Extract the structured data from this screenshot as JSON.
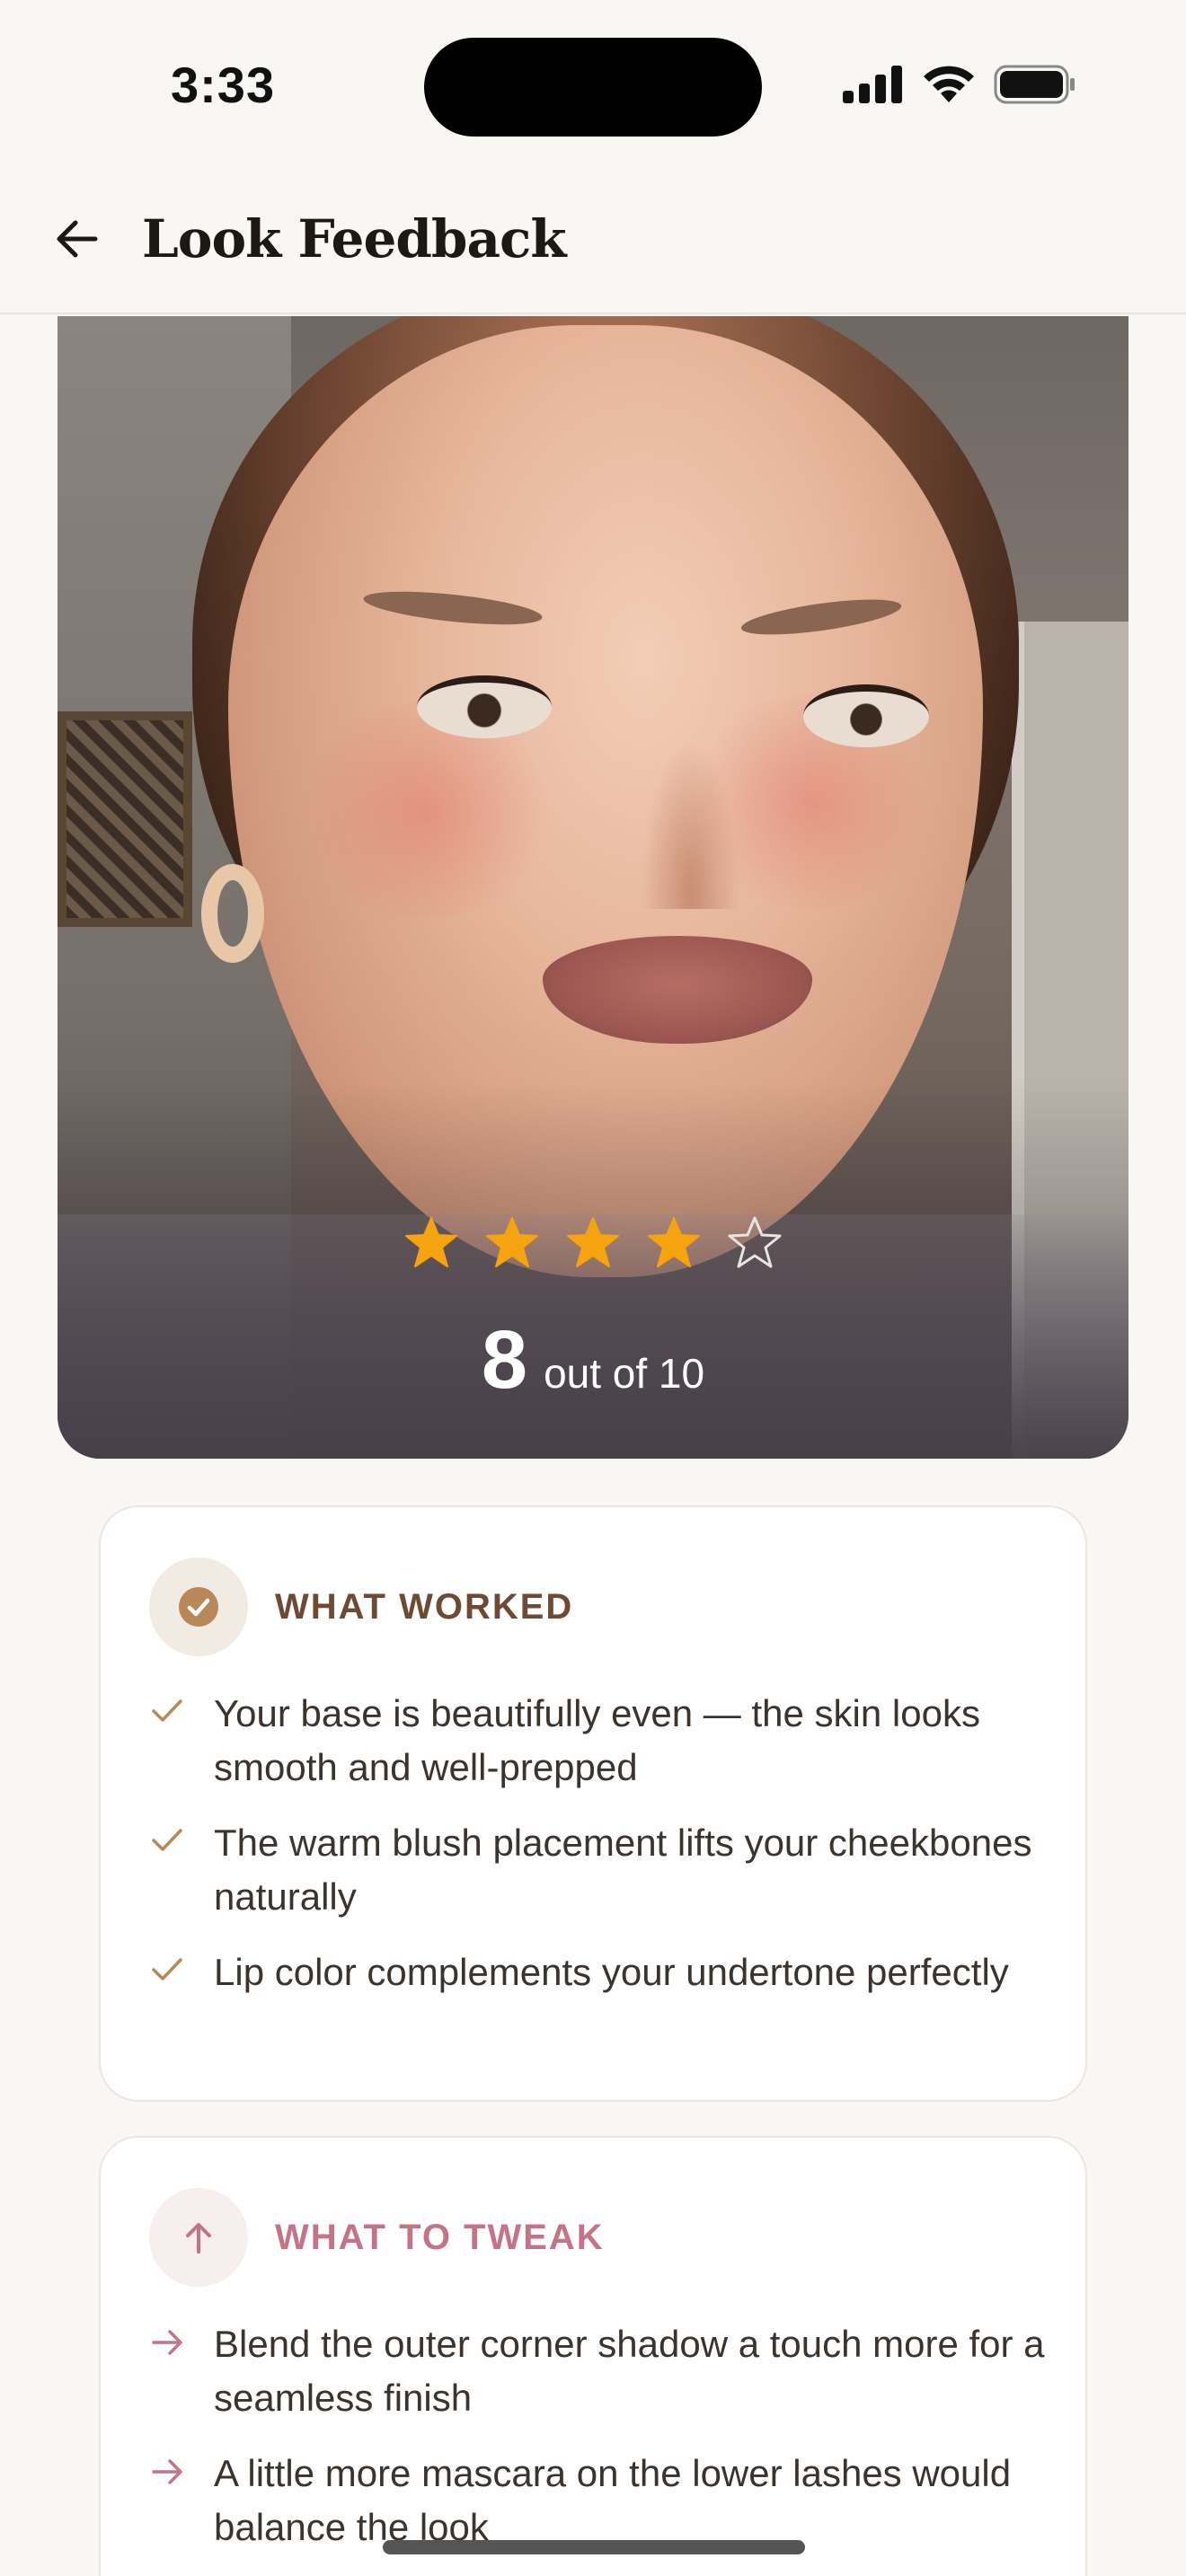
{
  "status_bar": {
    "time": "3:33"
  },
  "header": {
    "title": "Look Feedback"
  },
  "rating": {
    "stars_filled": 4,
    "stars_total": 5,
    "score": "8",
    "score_suffix": "out of 10"
  },
  "what_worked": {
    "heading": "WHAT WORKED",
    "items": [
      "Your base is beautifully even — the skin looks smooth and well-prepped",
      "The warm blush placement lifts your cheekbones naturally",
      "Lip color complements your undertone perfectly"
    ]
  },
  "what_to_tweak": {
    "heading": "WHAT TO TWEAK",
    "items": [
      "Blend the outer corner shadow a touch more for a seamless finish",
      "A little more mascara on the lower lashes would balance the look"
    ]
  },
  "colors": {
    "star": "#f5a30f",
    "worked_accent": "#b8875a",
    "tweak_accent": "#c47487"
  }
}
